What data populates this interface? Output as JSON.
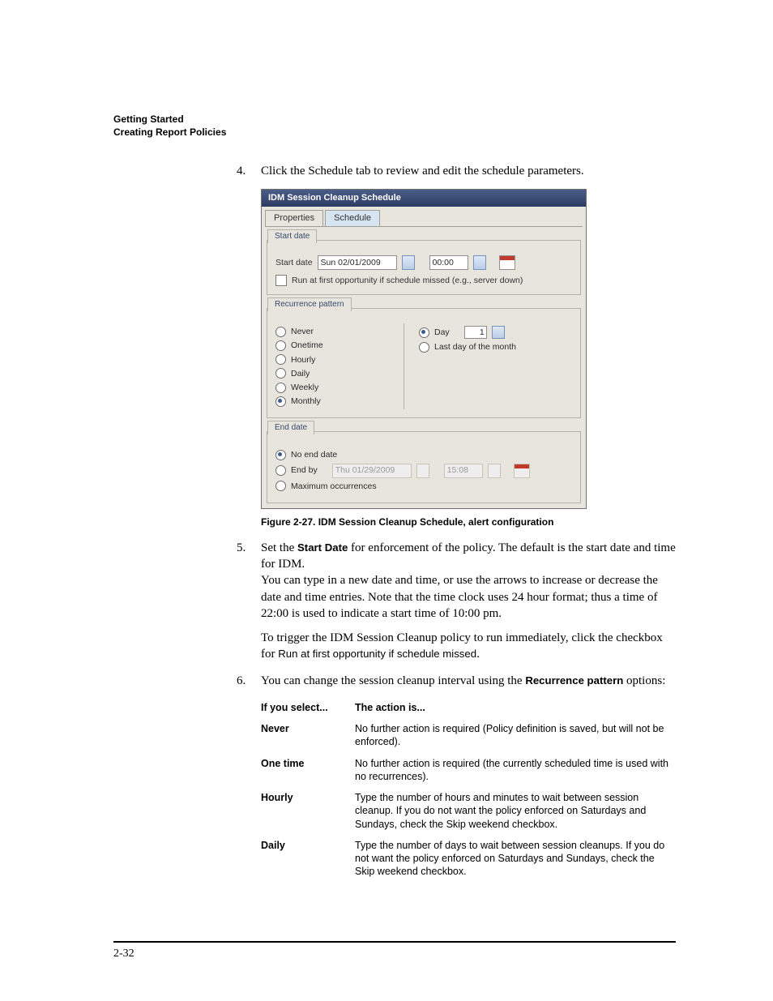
{
  "header": {
    "line1": "Getting Started",
    "line2": "Creating Report Policies"
  },
  "step4": {
    "num": "4.",
    "text": "Click the Schedule tab to review and edit the schedule parameters."
  },
  "dialog": {
    "title": "IDM Session Cleanup Schedule",
    "tabs": {
      "properties": "Properties",
      "schedule": "Schedule"
    },
    "start_section": {
      "title": "Start date",
      "label": "Start date",
      "date": "Sun 02/01/2009",
      "time": "00:00",
      "checkbox_label": "Run at first opportunity if schedule missed (e.g., server down)"
    },
    "recurrence": {
      "title": "Recurrence pattern",
      "options": {
        "never": "Never",
        "onetime": "Onetime",
        "hourly": "Hourly",
        "daily": "Daily",
        "weekly": "Weekly",
        "monthly": "Monthly"
      },
      "detail": {
        "day_label": "Day",
        "day_value": "1",
        "last_day": "Last day of the month"
      }
    },
    "end_section": {
      "title": "End date",
      "no_end": "No end date",
      "end_by": "End by",
      "end_by_date": "Thu 01/29/2009",
      "end_by_time": "15:08",
      "max_occ": "Maximum occurrences"
    }
  },
  "fig_caption": "Figure 2-27. IDM Session Cleanup Schedule, alert configuration",
  "step5": {
    "num": "5.",
    "p1a": "Set the ",
    "p1b": "Start Date",
    "p1c": " for enforcement of the policy. The default is the start date and time for IDM.",
    "p2": "You can type in a new date and time, or use the arrows to increase or decrease the date and time entries. Note that the time clock uses 24 hour format; thus a time of 22:00 is used to indicate a start time of 10:00 pm.",
    "p3a": "To trigger the IDM Session Cleanup policy to run immediately, click the checkbox for ",
    "p3b": "Run at first opportunity if schedule missed",
    "p3c": "."
  },
  "step6": {
    "num": "6.",
    "p1a": "You can change the session cleanup interval using the ",
    "p1b": "Recurrence pattern",
    "p1c": " options:"
  },
  "table": {
    "head_left": "If you select...",
    "head_right": "The action is...",
    "rows": [
      {
        "k": "Never",
        "v": "No further action is required (Policy definition is saved, but will not be enforced)."
      },
      {
        "k": "One time",
        "v": "No further action is required (the currently scheduled time is used with no recurrences)."
      },
      {
        "k": "Hourly",
        "v": "Type the number of hours and minutes to wait between session cleanup. If you do not want the policy enforced on Saturdays and Sundays, check the Skip weekend checkbox."
      },
      {
        "k": "Daily",
        "v": "Type the number of days to wait between session cleanups. If you do not want the policy enforced on Saturdays and Sundays, check the Skip weekend checkbox."
      }
    ]
  },
  "page_number": "2-32"
}
